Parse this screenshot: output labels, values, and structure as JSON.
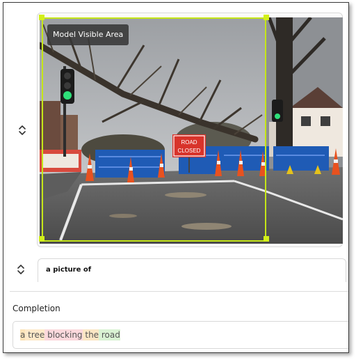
{
  "image_panel": {
    "area_label": "Model Visible Area",
    "sign_text_line1": "ROAD",
    "sign_text_line2": "CLOSED",
    "area_color": "#c5e617"
  },
  "prompt": {
    "text": "a picture of"
  },
  "completion": {
    "title": "Completion",
    "tokens": [
      {
        "text": "a",
        "bg": "#fbe3b8"
      },
      {
        "text": " tree",
        "bg": "#fde9c9"
      },
      {
        "text": " blocking",
        "bg": "#fbd8dc"
      },
      {
        "text": " the",
        "bg": "#fbe6c4"
      },
      {
        "text": " road",
        "bg": "#d9f2d3"
      }
    ]
  },
  "icons": {
    "reorder": "chevron-up-down-icon"
  }
}
